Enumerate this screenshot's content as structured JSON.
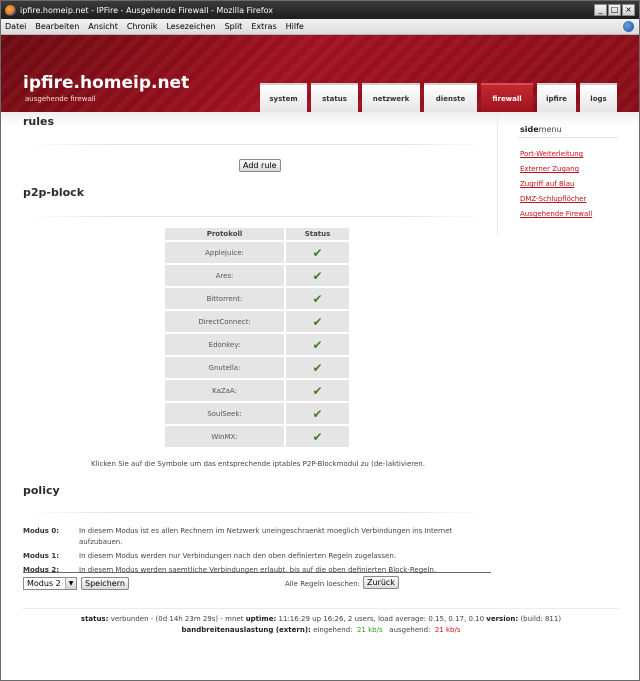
{
  "window": {
    "title": "ipfire.homeip.net - IPFire - Ausgehende Firewall - Mozilla Firefox",
    "controls": [
      "_",
      "□",
      "×"
    ]
  },
  "menubar": {
    "items": [
      "Datei",
      "Bearbeiten",
      "Ansicht",
      "Chronik",
      "Lesezeichen",
      "Split",
      "Extras",
      "Hilfe"
    ]
  },
  "header": {
    "hostname": "ipfire.homeip.net",
    "subtitle": "ausgehende firewall",
    "tabs": [
      {
        "label": "system",
        "active": false
      },
      {
        "label": "status",
        "active": false
      },
      {
        "label": "netzwerk",
        "active": false
      },
      {
        "label": "dienste",
        "active": false
      },
      {
        "label": "firewall",
        "active": true
      },
      {
        "label": "ipfire",
        "active": false
      },
      {
        "label": "logs",
        "active": false
      }
    ]
  },
  "rules": {
    "heading": "rules",
    "add_button": "Add rule"
  },
  "p2p": {
    "heading": "p2p-block",
    "columns": [
      "Protokoll",
      "Status"
    ],
    "rows": [
      {
        "protocol": "Applejuice:",
        "status": "enabled"
      },
      {
        "protocol": "Ares:",
        "status": "enabled"
      },
      {
        "protocol": "Bittorrent:",
        "status": "enabled"
      },
      {
        "protocol": "DirectConnect:",
        "status": "enabled"
      },
      {
        "protocol": "Edonkey:",
        "status": "enabled"
      },
      {
        "protocol": "Gnutella:",
        "status": "enabled"
      },
      {
        "protocol": "KaZaA:",
        "status": "enabled"
      },
      {
        "protocol": "SoulSeek:",
        "status": "enabled"
      },
      {
        "protocol": "WinMX:",
        "status": "enabled"
      }
    ],
    "status_icon": "check-icon",
    "hint": "Klicken Sie auf die Symbole um das entsprechende iptables P2P-Blockmodul zu (de-)aktivieren."
  },
  "policy": {
    "heading": "policy",
    "modes": [
      {
        "label": "Modus 0:",
        "text": "In diesem Modus ist es allen Rechnern im Netzwerk uneingeschraenkt moeglich Verbindungen ins Internet aufzubauen."
      },
      {
        "label": "Modus 1:",
        "text": "In diesem Modus werden nur Verbindungen nach den oben definierten Regeln zugelassen."
      },
      {
        "label": "Modus 2:",
        "text": "In diesem Modus werden saemtliche Verbindungen erlaubt, bis auf die oben definierten Block-Regeln."
      }
    ],
    "select_value": "Modus 2",
    "save_button": "Speichern",
    "delete_label": "Alle Regeln loeschen:",
    "back_button": "Zurück"
  },
  "sidebar": {
    "title_bold": "side",
    "title_rest": "menu",
    "links": [
      "Port-Weiterleitung",
      "Externer Zugang",
      "Zugriff auf Blau",
      "DMZ-Schlupflöcher",
      "Ausgehende Firewall"
    ]
  },
  "footer": {
    "status_label": "status:",
    "status_value": "verbunden - (0d 14h 23m 29s) - mnet",
    "uptime_label": "uptime:",
    "uptime_value": "11:16:29 up 16:26, 2 users, load average: 0.15, 0.17, 0.10",
    "version_label": "version:",
    "version_value": "(build: 811)",
    "bw_label": "bandbreitenauslastung (extern):",
    "in_label": "eingehend:",
    "in_value": "21 kb/s",
    "out_label": "ausgehend:",
    "out_value": "21 kb/s"
  },
  "colors": {
    "brand_red": "#a31221",
    "link_red": "#c2101c",
    "check_green": "#4b7a2b"
  }
}
